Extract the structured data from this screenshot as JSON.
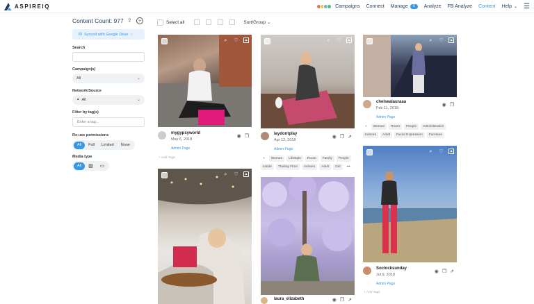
{
  "brand": {
    "name": "ASPIREIQ",
    "accent": "#3996e0"
  },
  "nav": {
    "items": [
      {
        "label": "Campaigns"
      },
      {
        "label": "Connect"
      },
      {
        "label": "Manage",
        "badge": "6"
      },
      {
        "label": "Analyze"
      },
      {
        "label": "FB Analyze"
      },
      {
        "label": "Content",
        "active": true
      },
      {
        "label": "Help"
      }
    ]
  },
  "sidebar": {
    "count_label": "Content Count: 977",
    "sync_label": "Synced with Google Drive",
    "search_label": "Search",
    "campaign_label": "Campaign(s)",
    "campaign_value": "All",
    "network_label": "Network/Source",
    "network_value": "All",
    "filter_tag_label": "Filter by tag(s)",
    "filter_tag_placeholder": "Enter a tag...",
    "reuse_label": "Re-use permissions",
    "reuse_options": [
      "All",
      "Full",
      "Limited",
      "None"
    ],
    "media_label": "Media type",
    "media_options": [
      "All"
    ]
  },
  "toolbar": {
    "select_all": "Select all",
    "sort_label": "Sort/Group"
  },
  "cards": [
    {
      "username": "mygypsyworld",
      "date": "May 6, 2018",
      "admin": "Admin Page",
      "tags": [],
      "add_tags": "Add Tags"
    },
    {
      "username": "laydontplay",
      "date": "Apr 12, 2018",
      "admin": "Admin Page",
      "tags": [
        "Woman",
        "Lifestyle",
        "Room",
        "Family",
        "People",
        "Inside",
        "Trading Floor",
        "Indoors",
        "Adult",
        "Girl",
        "•••"
      ]
    },
    {
      "username": "chelsealauraaa",
      "date": "Feb 11, 2018",
      "admin": "Admin Page",
      "tags": [
        "Woman",
        "Room",
        "People",
        "Administration",
        "Indoors",
        "Adult",
        "Facial Expression",
        "Furniture"
      ]
    },
    {
      "username": "",
      "date": "",
      "admin": "",
      "tags": []
    },
    {
      "username": "laura_elizabeth",
      "date": "",
      "admin": "",
      "tags": []
    },
    {
      "username": "Soclocksunday",
      "date": "Jul 9, 2018",
      "admin": "Admin Page",
      "tags": [],
      "add_tags": "Add Tags"
    }
  ]
}
